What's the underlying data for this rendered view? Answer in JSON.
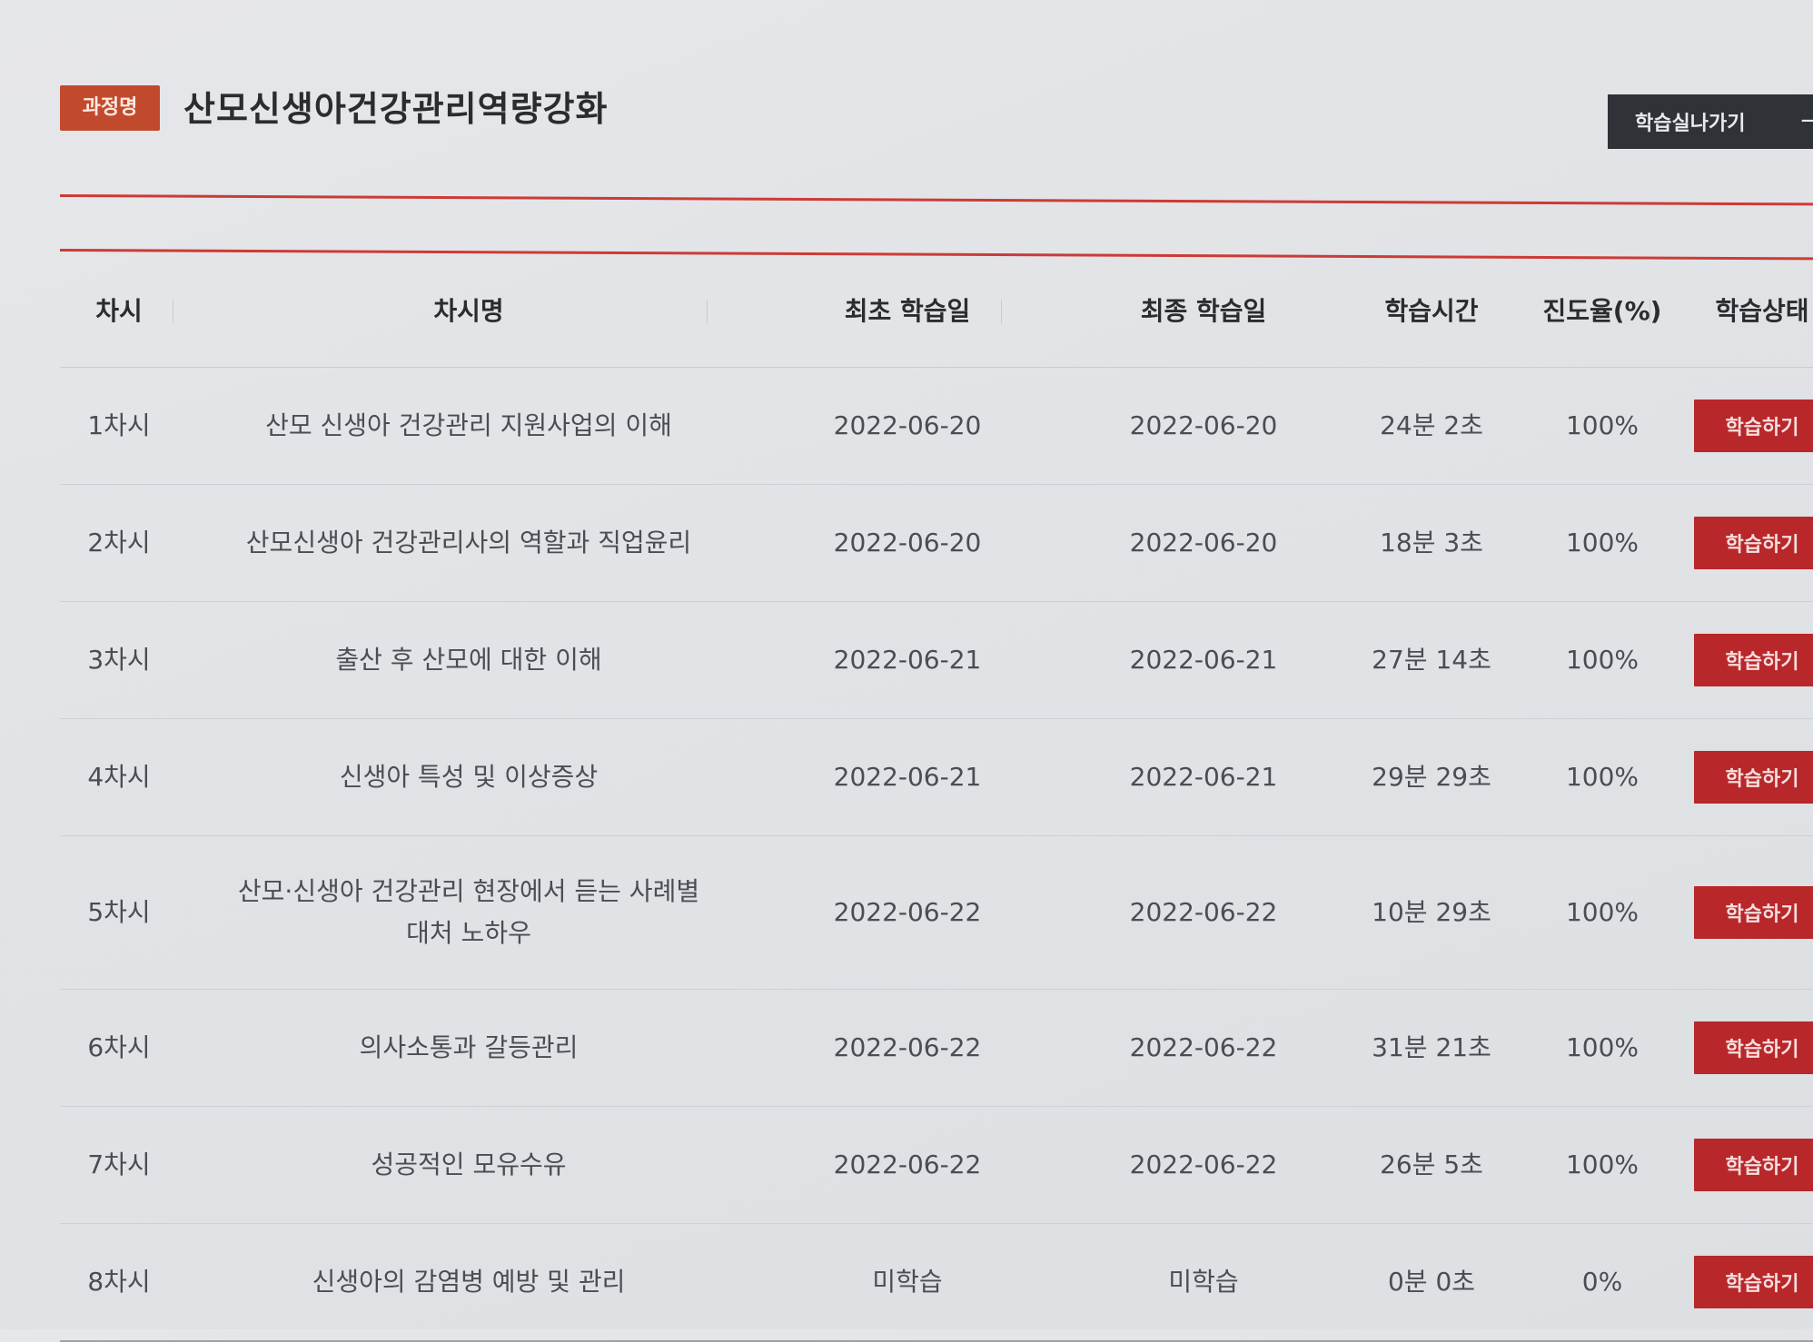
{
  "course": {
    "badge": "과정명",
    "title": "산모신생아건강관리역량강화",
    "go_button": "학습실나가기",
    "go_arrow": "→"
  },
  "table": {
    "headers": [
      "차시",
      "차시명",
      "최초 학습일",
      "최종 학습일",
      "학습시간",
      "진도율(%)",
      "학습상태"
    ],
    "rows": [
      {
        "session": "1차시",
        "name": "산모 신생아 건강관리 지원사업의 이해",
        "first": "2022-06-20",
        "last": "2022-06-20",
        "time": "24분 2초",
        "progress": "100%",
        "action": "학습하기"
      },
      {
        "session": "2차시",
        "name": "산모신생아 건강관리사의 역할과 직업윤리",
        "first": "2022-06-20",
        "last": "2022-06-20",
        "time": "18분 3초",
        "progress": "100%",
        "action": "학습하기"
      },
      {
        "session": "3차시",
        "name": "출산 후 산모에 대한 이해",
        "first": "2022-06-21",
        "last": "2022-06-21",
        "time": "27분 14초",
        "progress": "100%",
        "action": "학습하기"
      },
      {
        "session": "4차시",
        "name": "신생아 특성 및 이상증상",
        "first": "2022-06-21",
        "last": "2022-06-21",
        "time": "29분 29초",
        "progress": "100%",
        "action": "학습하기"
      },
      {
        "session": "5차시",
        "name": "산모·신생아 건강관리 현장에서 듣는 사례별 대처 노하우",
        "first": "2022-06-22",
        "last": "2022-06-22",
        "time": "10분 29초",
        "progress": "100%",
        "action": "학습하기"
      },
      {
        "session": "6차시",
        "name": "의사소통과 갈등관리",
        "first": "2022-06-22",
        "last": "2022-06-22",
        "time": "31분 21초",
        "progress": "100%",
        "action": "학습하기"
      },
      {
        "session": "7차시",
        "name": "성공적인 모유수유",
        "first": "2022-06-22",
        "last": "2022-06-22",
        "time": "26분 5초",
        "progress": "100%",
        "action": "학습하기"
      },
      {
        "session": "8차시",
        "name": "신생아의 감염병 예방 및 관리",
        "first": "미학습",
        "last": "미학습",
        "time": "0분 0초",
        "progress": "0%",
        "action": "학습하기"
      }
    ]
  },
  "colors": {
    "badge": "#c24a2c",
    "accent_rule": "#cc3b36",
    "study_button": "#b8272a",
    "exit_button": "#2f3236"
  }
}
